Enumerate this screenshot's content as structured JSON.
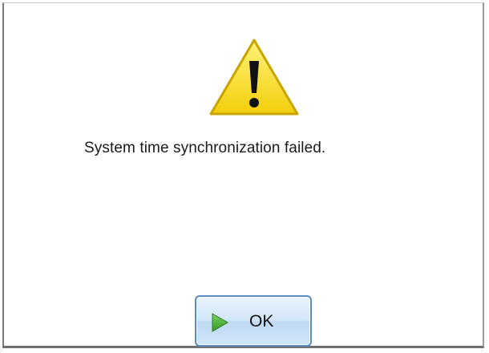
{
  "dialog": {
    "message": "System time synchronization failed.",
    "icon": "warning-icon",
    "warning_color": "#f6dc16"
  },
  "button": {
    "label": "OK",
    "icon": "play-icon",
    "icon_color": "#3ea62e"
  }
}
